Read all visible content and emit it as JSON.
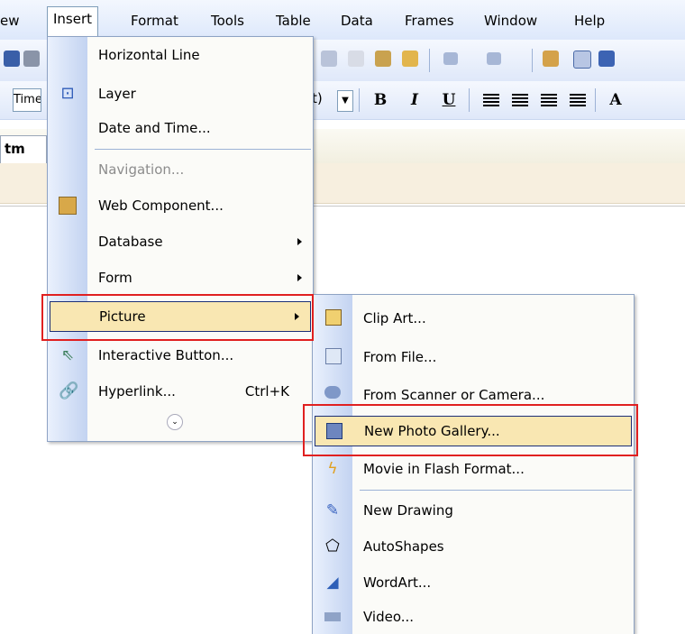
{
  "menubar": {
    "items": [
      "ew",
      "Insert",
      "Format",
      "Tools",
      "Table",
      "Data",
      "Frames",
      "Window",
      "Help"
    ],
    "underline_chars": [
      "",
      "I",
      "o",
      "T",
      "a",
      "D",
      "r",
      "W",
      "H"
    ]
  },
  "toolbar": {
    "font_name": "Time",
    "font_size_fragment": "t)",
    "bold": "B",
    "italic": "I",
    "underline": "U",
    "grow_font": "A"
  },
  "tab": {
    "label": "tm"
  },
  "insert_menu": {
    "items": [
      {
        "label": "Horizontal Line",
        "icon": "none",
        "submenu": false,
        "disabled": false
      },
      {
        "label": "Layer",
        "icon": "layer-icon",
        "submenu": false,
        "disabled": false
      },
      {
        "label": "Date and Time...",
        "icon": "none",
        "submenu": false,
        "disabled": false
      },
      {
        "label": "Navigation...",
        "icon": "none",
        "submenu": false,
        "disabled": true
      },
      {
        "label": "Web Component...",
        "icon": "web-component-icon",
        "submenu": false,
        "disabled": false
      },
      {
        "label": "Database",
        "icon": "none",
        "submenu": true,
        "disabled": false
      },
      {
        "label": "Form",
        "icon": "none",
        "submenu": true,
        "disabled": false
      },
      {
        "label": "Picture",
        "icon": "none",
        "submenu": true,
        "disabled": false,
        "highlighted": true
      },
      {
        "label": "Interactive Button...",
        "icon": "interactive-button-icon",
        "submenu": false,
        "disabled": false
      },
      {
        "label": "Hyperlink...",
        "icon": "hyperlink-icon",
        "submenu": false,
        "disabled": false,
        "shortcut": "Ctrl+K"
      }
    ]
  },
  "picture_submenu": {
    "items": [
      {
        "label": "Clip Art...",
        "icon": "clip-art-icon"
      },
      {
        "label": "From File...",
        "icon": "from-file-icon"
      },
      {
        "label": "From Scanner or Camera...",
        "icon": "scanner-icon"
      },
      {
        "label": "New Photo Gallery...",
        "icon": "photo-gallery-icon",
        "highlighted": true
      },
      {
        "label": "Movie in Flash Format...",
        "icon": "flash-icon"
      },
      {
        "label": "New Drawing",
        "icon": "drawing-icon"
      },
      {
        "label": "AutoShapes",
        "icon": "autoshapes-icon"
      },
      {
        "label": "WordArt...",
        "icon": "wordart-icon"
      },
      {
        "label": "Video...",
        "icon": "video-icon"
      }
    ]
  },
  "colors": {
    "highlight_fill": "#f9e7b2",
    "highlight_border": "#1c2f76",
    "annotation_red": "#e02020",
    "gutter_blue": "#c3d3f1"
  }
}
